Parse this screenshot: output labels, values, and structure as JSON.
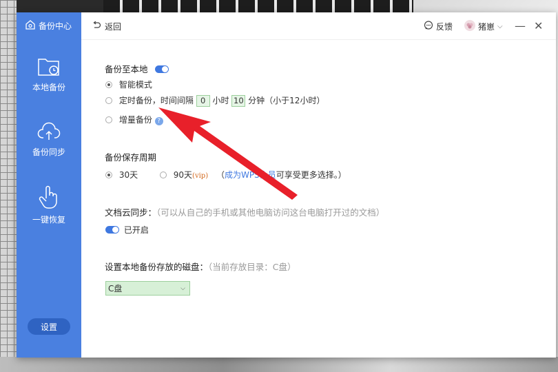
{
  "sidebar": {
    "title": "备份中心",
    "items": [
      {
        "label": "本地备份",
        "icon": "folder-clock-icon"
      },
      {
        "label": "备份同步",
        "icon": "cloud-upload-icon"
      },
      {
        "label": "一键恢复",
        "icon": "hand-pointer-icon"
      }
    ],
    "settings_label": "设置"
  },
  "topbar": {
    "back_label": "返回",
    "feedback_label": "反馈",
    "user_name": "猪崽"
  },
  "local_backup": {
    "title": "备份至本地",
    "enabled": true,
    "options": {
      "smart": "智能模式",
      "timed_prefix": "定时备份，时间间隔",
      "hours_value": "0",
      "hours_unit": "小时",
      "minutes_value": "10",
      "minutes_unit": "分钟（小于12小时）",
      "incremental": "增量备份"
    },
    "selected": "smart"
  },
  "retention": {
    "title": "备份保存周期",
    "opt_30": "30天",
    "opt_90": "90天",
    "vip_tag": "(vip)",
    "note_open": "（",
    "note_link": "成为WPS会员",
    "note_rest": "可享受更多选择。）",
    "selected": "30天"
  },
  "cloud_sync": {
    "title": "文档云同步：",
    "hint": "（可以从自己的手机或其他电脑访问这台电脑打开过的文档）",
    "status": "已开启"
  },
  "disk": {
    "title": "设置本地备份存放的磁盘：",
    "hint": "（当前存放目录：C盘）",
    "selected": "C盘"
  },
  "colors": {
    "sidebar": "#4a80e0",
    "accent": "#3f78e0",
    "arrow": "#e8202a",
    "input_green": "#d7f0d7"
  }
}
